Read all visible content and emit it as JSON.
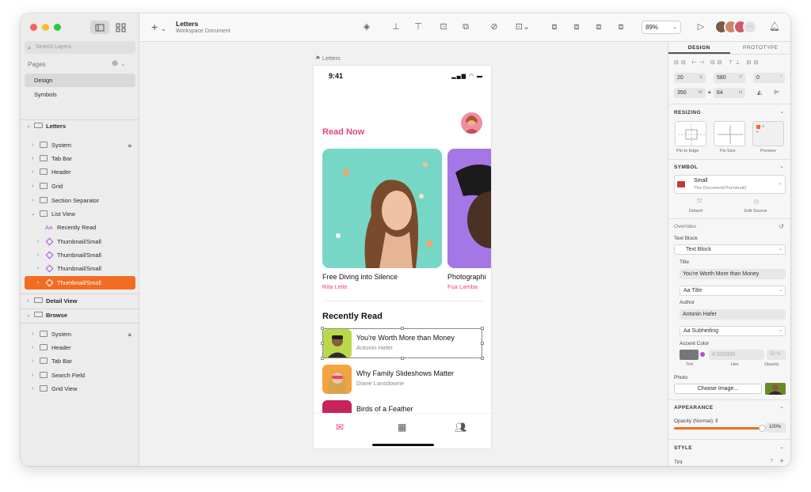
{
  "colors": {
    "accent_orange": "#f26c23",
    "pink": "#e8457a",
    "purple": "#b14fd8",
    "close": "#fe5f57",
    "minimize": "#febc2e",
    "maximize": "#28c840"
  },
  "sidebar": {
    "search_placeholder": "Search Layers",
    "pages_label": "Pages",
    "pages": [
      "Design",
      "Symbols"
    ],
    "artboard1": {
      "name": "Letters",
      "layers": [
        "System",
        "Tab Bar",
        "Header",
        "Grid",
        "Section Separator",
        "List View"
      ],
      "list_children": [
        "Recently Read",
        "Thumbnail/Small",
        "Thumbnail/Small",
        "Thumbnail/Small",
        "Thumbnail/Small"
      ]
    },
    "artboard2": {
      "name": "Detail View"
    },
    "artboard3": {
      "name": "Browse",
      "layers": [
        "System",
        "Header",
        "Tab Bar",
        "Search Field",
        "Grid View"
      ]
    }
  },
  "toolbar": {
    "doc_title": "Letters",
    "doc_subtitle": "Workspace Document",
    "zoom": "89%"
  },
  "canvas": {
    "artboard_label": "Letters",
    "status_time": "9:41",
    "read_now": "Read Now",
    "cards": [
      {
        "title": "Free Diving into Silence",
        "author": "Rita Leite"
      },
      {
        "title": "Photographi",
        "author": "Fua Lamba"
      }
    ],
    "recently_read": "Recently Read",
    "list": [
      {
        "title": "You're Worth More than Money",
        "author": "Antonin Hafer"
      },
      {
        "title": "Why Family Slideshows Matter",
        "author": "Diane Lansdowne"
      },
      {
        "title": "Birds of a Feather",
        "author": ""
      }
    ]
  },
  "inspector": {
    "tabs": [
      "DESIGN",
      "PROTOTYPE"
    ],
    "x": "20",
    "y": "580",
    "rotation": "0",
    "w": "350",
    "h": "64",
    "resizing": "RESIZING",
    "resize_options": [
      "Pin to Edge",
      "Fix Size",
      "Preview"
    ],
    "symbol": "SYMBOL",
    "symbol_name": "Small",
    "symbol_source": "This Document(Thumbnail)",
    "detach": "Detach",
    "edit_source": "Edit Source",
    "overrides": "Overrides",
    "text_block_label": "Text Block",
    "text_block_value": "Text Block",
    "title_label": "Title",
    "title_value": "You're Worth More than Money",
    "title_style": "Aa Title",
    "author_label": "Author",
    "author_value": "Antonin Hafer",
    "author_style": "Aa Subheding",
    "accent_label": "Accent Color",
    "accent_hex": "000000",
    "accent_opacity": "50 %",
    "tint": "Tint",
    "hex": "Hex",
    "opacity": "Opacity",
    "photo_label": "Photo",
    "choose_image": "Choose Image...",
    "appearance": "APPEARANCE",
    "opacity_normal": "Opacity (Normal)",
    "opacity_value": "100%",
    "opacity_fraction": 1.0,
    "style": "STYLE",
    "tint_section": "Tint"
  }
}
